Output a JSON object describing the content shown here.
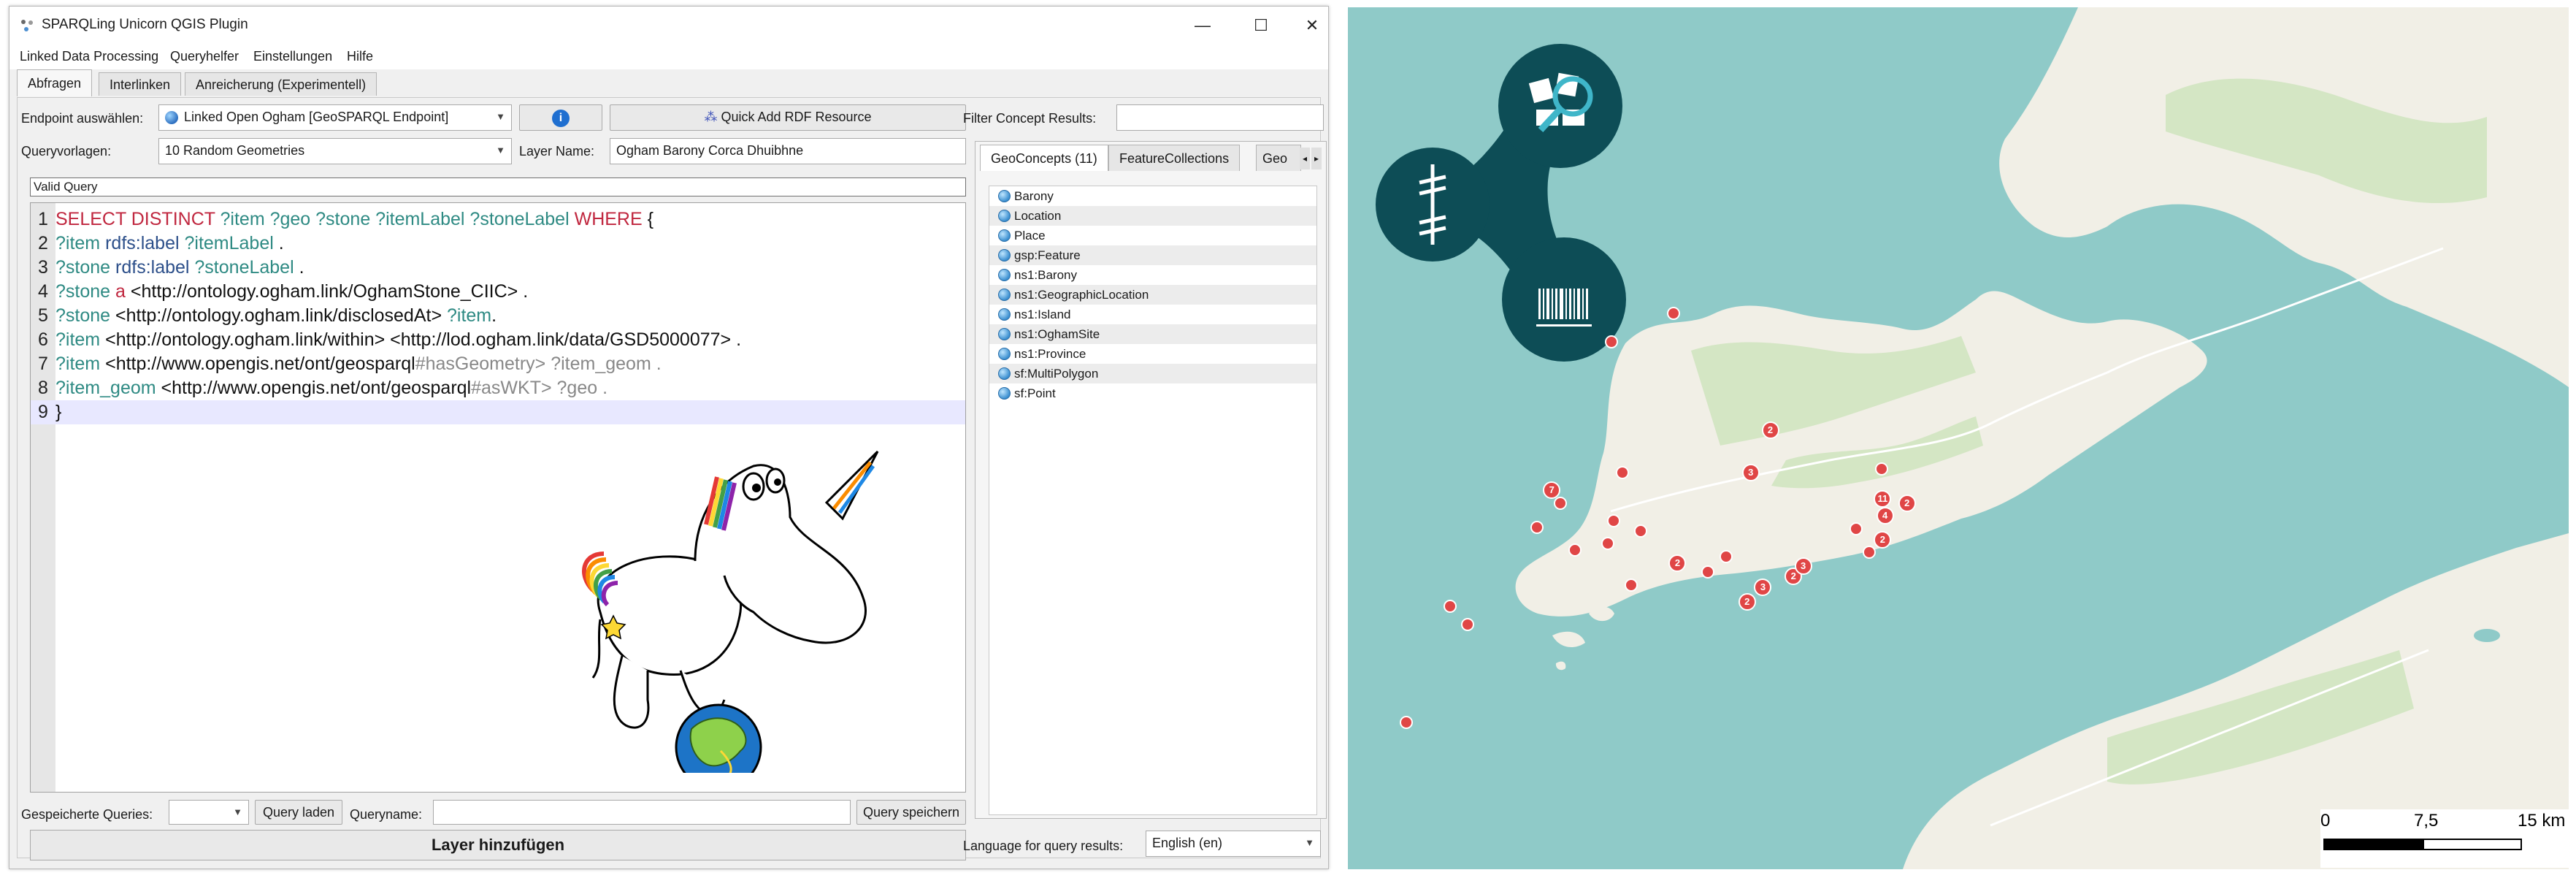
{
  "window": {
    "title": "SPARQLing Unicorn QGIS Plugin",
    "controls": [
      "—",
      "☐",
      "✕"
    ]
  },
  "menu": [
    "Linked Data Processing",
    "Queryhelfer",
    "Einstellungen",
    "Hilfe"
  ],
  "tabs": [
    "Abfragen",
    "Interlinken",
    "Anreicherung (Experimentell)"
  ],
  "form": {
    "endpoint_label": "Endpoint auswählen:",
    "endpoint_value": "Linked Open Ogham [GeoSPARQL Endpoint]",
    "info_icon": "i",
    "quick_add_label": "Quick Add RDF Resource",
    "filter_label": "Filter Concept Results:",
    "filter_value": "",
    "template_label": "Queryvorlagen:",
    "template_value": "10 Random Geometries",
    "layer_name_label": "Layer Name:",
    "layer_name_value": "Ogham Barony Corca Dhuibhne",
    "status": "Valid Query"
  },
  "query_lines": [
    {
      "n": "1",
      "parts": [
        [
          "kw",
          "SELECT DISTINCT "
        ],
        [
          "var",
          "?item ?geo ?stone ?itemLabel ?stoneLabel "
        ],
        [
          "kw",
          "WHERE "
        ],
        [
          "lit",
          "{"
        ]
      ]
    },
    {
      "n": "2",
      "parts": [
        [
          "var",
          "?item "
        ],
        [
          "pred",
          "rdfs:label "
        ],
        [
          "var",
          "?itemLabel "
        ],
        [
          "lit",
          "."
        ]
      ]
    },
    {
      "n": "3",
      "parts": [
        [
          "var",
          "?stone "
        ],
        [
          "pred",
          "rdfs:label "
        ],
        [
          "var",
          "?stoneLabel "
        ],
        [
          "lit",
          "."
        ]
      ]
    },
    {
      "n": "4",
      "parts": [
        [
          "var",
          "?stone "
        ],
        [
          "kw",
          "a "
        ],
        [
          "iri",
          "<http://ontology.ogham.link/OghamStone_CIIC> ."
        ]
      ]
    },
    {
      "n": "5",
      "parts": [
        [
          "var",
          "?stone "
        ],
        [
          "iri",
          "<http://ontology.ogham.link/disclosedAt> "
        ],
        [
          "var",
          "?item"
        ],
        [
          "lit",
          "."
        ]
      ]
    },
    {
      "n": "6",
      "parts": [
        [
          "var",
          "?item "
        ],
        [
          "iri",
          "<http://ontology.ogham.link/within> <http://lod.ogham.link/data/GSD5000077> ."
        ]
      ]
    },
    {
      "n": "7",
      "parts": [
        [
          "var",
          "?item "
        ],
        [
          "iri",
          "<http://www.opengis.net/ont/geosparql"
        ],
        [
          "frag",
          "#hasGeometry> ?item_geom ."
        ]
      ]
    },
    {
      "n": "8",
      "parts": [
        [
          "var",
          "?item_geom "
        ],
        [
          "iri",
          "<http://www.opengis.net/ont/geosparql"
        ],
        [
          "frag",
          "#asWKT> ?geo ."
        ]
      ]
    },
    {
      "n": "9",
      "parts": [
        [
          "lit",
          "}"
        ]
      ]
    }
  ],
  "concept_tabs": [
    "GeoConcepts (11)",
    "FeatureCollections",
    "Geo"
  ],
  "concepts": [
    "Barony",
    "Location",
    "Place",
    "gsp:Feature",
    "ns1:Barony",
    "ns1:GeographicLocation",
    "ns1:Island",
    "ns1:OghamSite",
    "ns1:Province",
    "sf:MultiPolygon",
    "sf:Point"
  ],
  "bottom": {
    "saved_label": "Gespeicherte Queries:",
    "saved_value": "",
    "load_button": "Query laden",
    "queryname_label": "Queryname:",
    "queryname_value": "",
    "save_button": "Query speichern",
    "add_layer_button": "Layer hinzufügen",
    "language_label": "Language for query results:",
    "language_value": "English (en)"
  },
  "map": {
    "markers": [
      {
        "lon": 0.216,
        "lat": 0.388,
        "count": ""
      },
      {
        "lon": 0.267,
        "lat": 0.355,
        "count": ""
      },
      {
        "lon": 0.346,
        "lat": 0.491,
        "count": "2"
      },
      {
        "lon": 0.167,
        "lat": 0.56,
        "count": "7"
      },
      {
        "lon": 0.174,
        "lat": 0.575,
        "count": ""
      },
      {
        "lon": 0.225,
        "lat": 0.54,
        "count": ""
      },
      {
        "lon": 0.155,
        "lat": 0.603,
        "count": ""
      },
      {
        "lon": 0.186,
        "lat": 0.63,
        "count": ""
      },
      {
        "lon": 0.213,
        "lat": 0.622,
        "count": ""
      },
      {
        "lon": 0.218,
        "lat": 0.596,
        "count": ""
      },
      {
        "lon": 0.24,
        "lat": 0.608,
        "count": ""
      },
      {
        "lon": 0.232,
        "lat": 0.67,
        "count": ""
      },
      {
        "lon": 0.27,
        "lat": 0.645,
        "count": "2"
      },
      {
        "lon": 0.295,
        "lat": 0.655,
        "count": ""
      },
      {
        "lon": 0.31,
        "lat": 0.637,
        "count": ""
      },
      {
        "lon": 0.327,
        "lat": 0.69,
        "count": "2"
      },
      {
        "lon": 0.34,
        "lat": 0.673,
        "count": "3"
      },
      {
        "lon": 0.365,
        "lat": 0.66,
        "count": "2"
      },
      {
        "lon": 0.373,
        "lat": 0.648,
        "count": "3"
      },
      {
        "lon": 0.33,
        "lat": 0.54,
        "count": "3"
      },
      {
        "lon": 0.416,
        "lat": 0.605,
        "count": ""
      },
      {
        "lon": 0.427,
        "lat": 0.632,
        "count": ""
      },
      {
        "lon": 0.438,
        "lat": 0.618,
        "count": "2"
      },
      {
        "lon": 0.44,
        "lat": 0.59,
        "count": "4"
      },
      {
        "lon": 0.438,
        "lat": 0.57,
        "count": "11"
      },
      {
        "lon": 0.437,
        "lat": 0.536,
        "count": ""
      },
      {
        "lon": 0.458,
        "lat": 0.575,
        "count": "2"
      },
      {
        "lon": 0.084,
        "lat": 0.695,
        "count": ""
      },
      {
        "lon": 0.098,
        "lat": 0.716,
        "count": ""
      },
      {
        "lon": 0.048,
        "lat": 0.83,
        "count": ""
      }
    ],
    "scale_labels": [
      "0",
      "7,5",
      "15 km"
    ],
    "colors": {
      "sea": "#8fcac8",
      "land": "#f1efe6",
      "green": "#d4e6c4",
      "marker": "#e04646",
      "logo": "#0d4d56"
    }
  }
}
